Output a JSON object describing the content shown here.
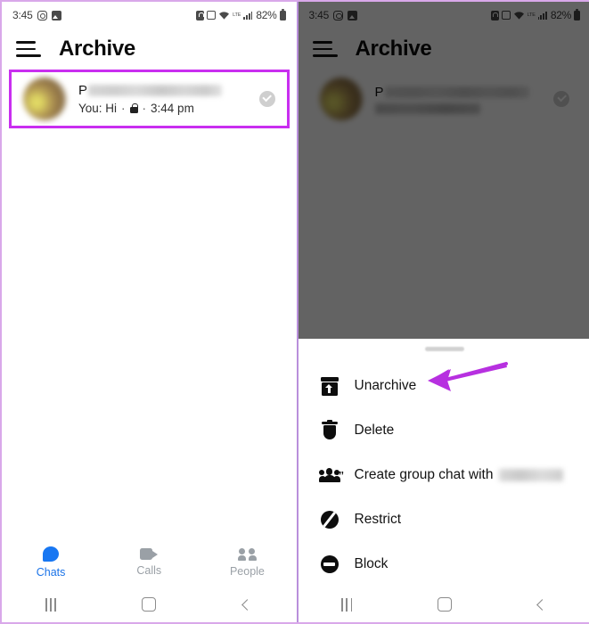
{
  "status_bar": {
    "time": "3:45",
    "battery_percent": "82%",
    "left_icons": [
      "instagram-icon",
      "photo-icon"
    ],
    "right_icons": [
      "battery-saver-icon",
      "alarm-icon",
      "wifi-icon",
      "lte-signal-icon",
      "signal-bars-icon",
      "battery-icon"
    ],
    "network_label": "LTE"
  },
  "app_bar": {
    "menu_icon": "hamburger-icon",
    "title": "Archive"
  },
  "chat_row": {
    "avatar": "contact-avatar-blurred",
    "name_visible": "P",
    "name_blurred": true,
    "preview_prefix": "You: Hi",
    "separator": "·",
    "lock_icon": "lock-icon",
    "time": "3:44 pm",
    "selected_icon": "check-circle-icon",
    "highlight_color": "#c92ef0"
  },
  "tab_bar": {
    "active_index": 0,
    "tabs": [
      {
        "label": "Chats",
        "icon": "chat-bubble-icon",
        "active": true
      },
      {
        "label": "Calls",
        "icon": "video-camera-icon",
        "active": false
      },
      {
        "label": "People",
        "icon": "people-icon",
        "active": false
      }
    ],
    "active_color": "#1a73e8",
    "inactive_color": "#9aa0a6"
  },
  "system_nav": {
    "recents": "recents-icon",
    "home": "home-icon",
    "back": "back-icon"
  },
  "bottom_sheet": {
    "handle": "drag-handle",
    "items": [
      {
        "label": "Unarchive",
        "icon": "unarchive-icon",
        "blurred_name": false
      },
      {
        "label": "Delete",
        "icon": "trash-icon",
        "blurred_name": false
      },
      {
        "label": "Create group chat with",
        "icon": "group-chat-icon",
        "blurred_name": true
      },
      {
        "label": "Restrict",
        "icon": "restrict-icon",
        "blurred_name": false
      },
      {
        "label": "Block",
        "icon": "block-icon",
        "blurred_name": false
      }
    ]
  },
  "annotation": {
    "arrow_color": "#b730e0",
    "points_to": "Unarchive"
  }
}
